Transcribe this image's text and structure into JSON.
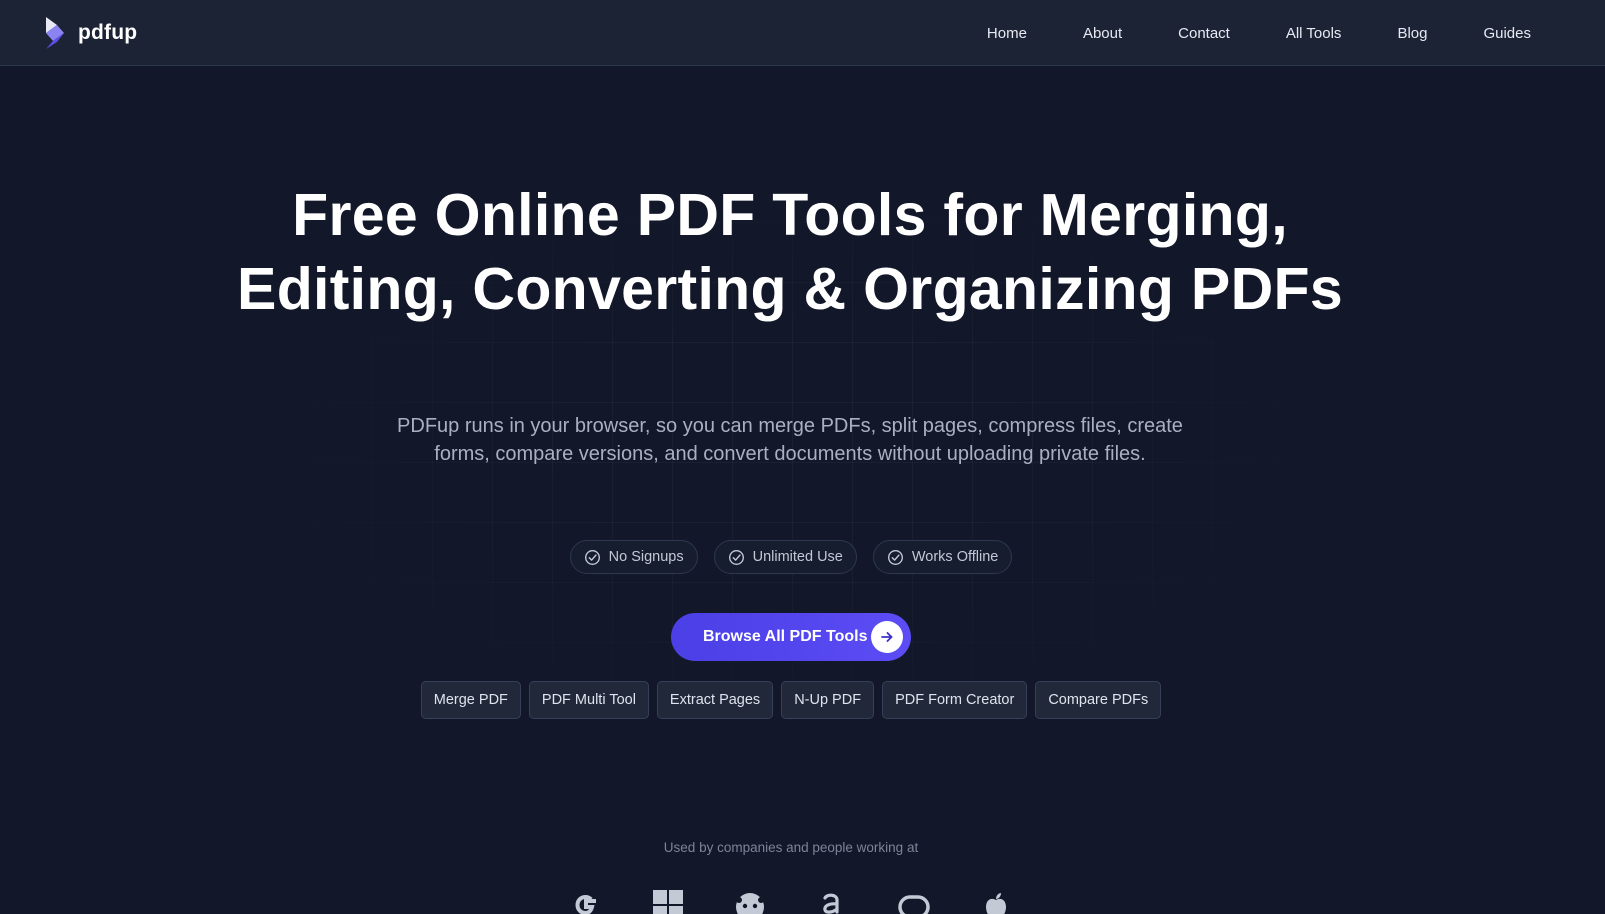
{
  "brand": {
    "name": "pdfup"
  },
  "nav": {
    "items": [
      "Home",
      "About",
      "Contact",
      "All Tools",
      "Blog",
      "Guides"
    ]
  },
  "hero": {
    "title": "Free Online PDF Tools for Merging, Editing, Converting & Organizing PDFs",
    "subtitle": "PDFup runs in your browser, so you can merge PDFs, split pages, compress files, create forms, compare versions, and convert documents without uploading private files.",
    "features": [
      "No Signups",
      "Unlimited Use",
      "Works Offline"
    ],
    "cta_label": "Browse All PDF Tools"
  },
  "tools": [
    "Merge PDF",
    "PDF Multi Tool",
    "Extract Pages",
    "N-Up PDF",
    "PDF Form Creator",
    "Compare PDFs"
  ],
  "used_by": {
    "text": "Used by companies and people working at",
    "logos": [
      "google-logo-icon",
      "microsoft-logo-icon",
      "reddit-logo-icon",
      "amazon-logo-icon",
      "meta-logo-icon",
      "apple-logo-icon"
    ]
  },
  "colors": {
    "background": "#121829",
    "navbar": "#1c2335",
    "accent": "#5446f0",
    "chip_bg": "#202839"
  }
}
